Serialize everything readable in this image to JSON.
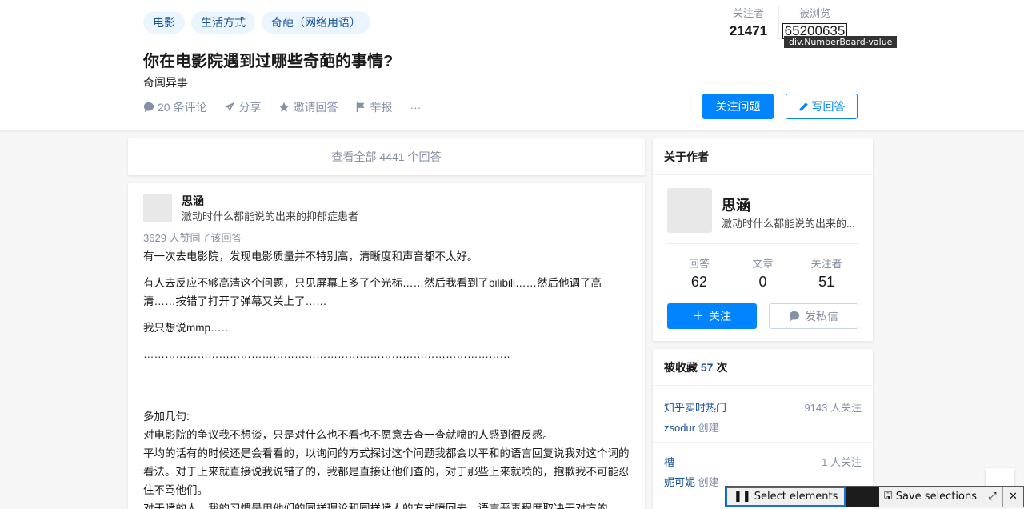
{
  "header": {
    "topics": [
      "电影",
      "生活方式",
      "奇葩（网络用语）"
    ],
    "title": "你在电影院遇到过哪些奇葩的事情?",
    "detail": "奇闻异事",
    "actions": {
      "comments": "20 条评论",
      "share": "分享",
      "invite": "邀请回答",
      "report": "举报",
      "more": "···"
    },
    "numboard": {
      "followers_label": "关注者",
      "followers_value": "21471",
      "views_label": "被浏览",
      "views_value": "65200635"
    },
    "tooltip": "div.NumberBoard-value",
    "follow_button": "关注问题",
    "answer_button": "写回答"
  },
  "main": {
    "view_all": "查看全部 4441 个回答",
    "answer": {
      "author_name": "思涵",
      "author_headline": "激动时什么都能说的出来的抑郁症患者",
      "votes": "3629 人赞同了该回答",
      "paragraphs": [
        "有一次去电影院，发现电影质量并不特别高，清晰度和声音都不太好。",
        "有人去反应不够高清这个问题，只见屏幕上多了个光标……然后我看到了bilibili……然后他调了高清……按错了打开了弹幕又关上了……",
        "我只想说mmp……",
        "…………………………………………………………………………………………"
      ],
      "more_lines": [
        "多加几句:",
        "对电影院的争议我不想谈，只是对什么也不看也不愿意去查一查就喷的人感到很反感。",
        "平均的话有的时候还是会看看的，以询问的方式探讨这个问题我都会以平和的语言回复说我对这个词的看法。对于上来就直接说我说错了的，我都是直接让他们查的，对于那些上来就喷的，抱歉我不可能忍住不骂他们。",
        "对于喷的人，我的习惯是用他们的同样理论和同样喷人的方式喷回去。语言恶毒程度取决于对方的"
      ]
    }
  },
  "sidebar": {
    "about_title": "关于作者",
    "author_name": "思涵",
    "author_headline": "激动时什么都能说的出来的...",
    "stats": [
      {
        "label": "回答",
        "value": "62"
      },
      {
        "label": "文章",
        "value": "0"
      },
      {
        "label": "关注者",
        "value": "51"
      }
    ],
    "follow_button": "关注",
    "message_button": "发私信",
    "collect_prefix": "被收藏",
    "collect_count": "57",
    "collect_suffix": "次",
    "collections": [
      {
        "title": "知乎实时热门",
        "followers": "9143 人关注",
        "creator": "zsodur",
        "created": "创建"
      },
      {
        "title": "槽",
        "followers": "1 人关注",
        "creator": "妮可妮",
        "created": "创建"
      }
    ]
  },
  "toolbar": {
    "select": "Select elements",
    "save": "Save selections"
  },
  "colors": {
    "accent": "#0084ff",
    "link": "#175199",
    "muted": "#8590a6"
  }
}
